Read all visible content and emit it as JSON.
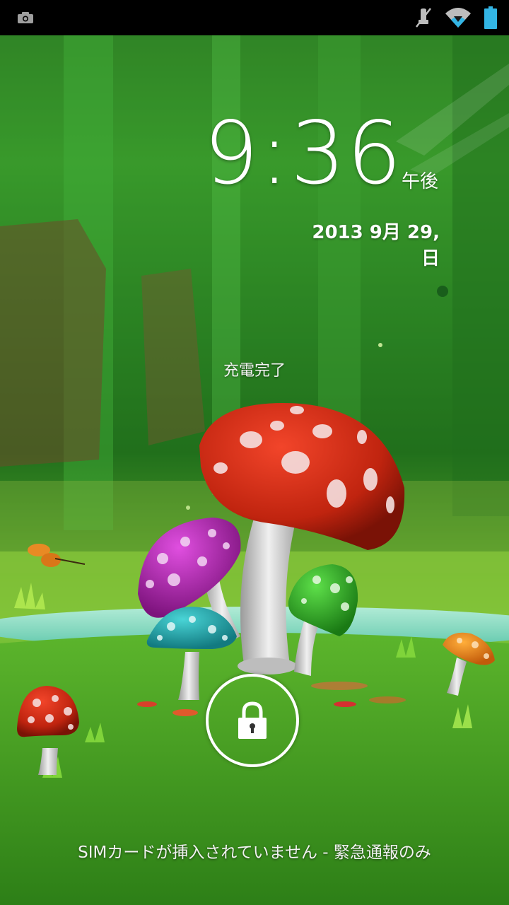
{
  "status_bar": {
    "icons": [
      "screenshot-icon",
      "mute-icon",
      "wifi-icon",
      "battery-icon"
    ],
    "colors": {
      "background": "#000000",
      "battery": "#33b5e5",
      "icons": "#bdbdbd"
    }
  },
  "lockscreen": {
    "time": "9:36",
    "ampm": "午後",
    "date": "2013 9月 29, 日",
    "charge_status": "充電完了",
    "unlock_icon": "lock-icon",
    "carrier_text": "SIMカードが挿入されていません - 緊急通報のみ"
  },
  "wallpaper": {
    "theme": "mushroom-forest"
  }
}
